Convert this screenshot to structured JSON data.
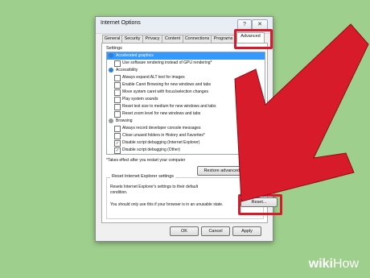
{
  "window": {
    "title": "Internet Options",
    "help_glyph": "?",
    "close_glyph": "✕"
  },
  "tabs": [
    {
      "label": "General"
    },
    {
      "label": "Security"
    },
    {
      "label": "Privacy"
    },
    {
      "label": "Content"
    },
    {
      "label": "Connections"
    },
    {
      "label": "Programs"
    },
    {
      "label": "Advanced",
      "active": true
    }
  ],
  "settings": {
    "label": "Settings",
    "items": [
      {
        "label": "Accelerated graphics",
        "kind": "category",
        "selected": true
      },
      {
        "label": "Use software rendering instead of GPU rendering*",
        "kind": "checkbox",
        "checked": false
      },
      {
        "label": "Accessibility",
        "kind": "category",
        "selected": false
      },
      {
        "label": "Always expand ALT text for images",
        "kind": "checkbox",
        "checked": false
      },
      {
        "label": "Enable Caret Browsing for new windows and tabs",
        "kind": "checkbox",
        "checked": false
      },
      {
        "label": "Move system caret with focus/selection changes",
        "kind": "checkbox",
        "checked": false
      },
      {
        "label": "Play system sounds",
        "kind": "checkbox",
        "checked": false
      },
      {
        "label": "Reset text size to medium for new windows and tabs",
        "kind": "checkbox",
        "checked": false
      },
      {
        "label": "Reset zoom level for new windows and tabs",
        "kind": "checkbox",
        "checked": false
      },
      {
        "label": "Browsing",
        "kind": "category",
        "selected": false
      },
      {
        "label": "Always record developer console messages",
        "kind": "checkbox",
        "checked": false
      },
      {
        "label": "Close unused folders in History and Favorites*",
        "kind": "checkbox",
        "checked": false
      },
      {
        "label": "Disable script debugging (Internet Explorer)",
        "kind": "checkbox",
        "checked": true
      },
      {
        "label": "Disable script debugging (Other)",
        "kind": "checkbox",
        "checked": true
      }
    ],
    "check_glyph": "✓",
    "restart_note": "*Takes effect after you restart your computer",
    "restore_button": "Restore advanced settings"
  },
  "reset_group": {
    "title": "Reset Internet Explorer settings",
    "text1": "Resets Internet Explorer's settings to their default",
    "text2": "condition.",
    "reset_button": "Reset...",
    "text3": "You should only use this if your browser is in an unusable state."
  },
  "footer": {
    "ok": "OK",
    "cancel": "Cancel",
    "apply": "Apply"
  },
  "watermark": {
    "prefix": "wiki",
    "suffix": "How"
  },
  "colors": {
    "background": "#9fcf8d",
    "arrow": "#d81b2a",
    "selection": "#3399ff"
  }
}
